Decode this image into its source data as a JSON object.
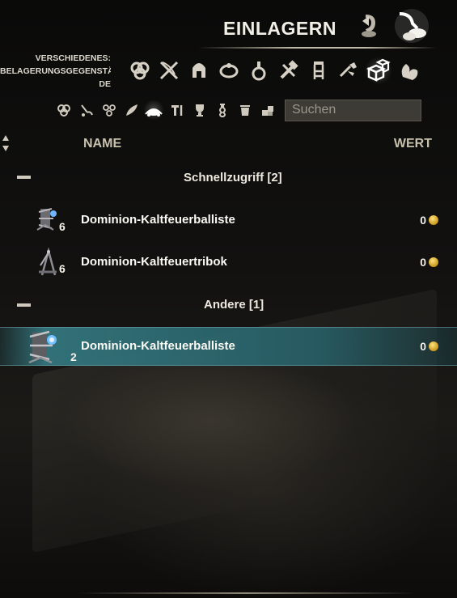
{
  "header": {
    "title": "EINLAGERN",
    "modes": [
      {
        "name": "withdraw-icon",
        "selected": false
      },
      {
        "name": "deposit-icon",
        "selected": true
      }
    ]
  },
  "category": {
    "label_line1": "VERSCHIEDENES:",
    "label_line2": "BELAGERUNGSGEGENSTÄN",
    "label_line3": "DE",
    "icons": [
      "all-icon",
      "weapons-icon",
      "armor-icon",
      "jewelry-icon",
      "consumables-icon",
      "crafting-icon",
      "furnishing-icon",
      "misc-icon",
      "siege-items-icon",
      "companion-icon"
    ],
    "selected_index": 8
  },
  "subfilters": {
    "icons": [
      "all-sub-icon",
      "tools-icon",
      "rings-icon",
      "horn-icon",
      "siege-sub-icon",
      "repair-icon",
      "trophy-icon",
      "potion-icon",
      "trash-icon",
      "boxes-icon"
    ],
    "selected_index": 4
  },
  "search": {
    "placeholder": "Suchen",
    "value": ""
  },
  "columns": {
    "name": "NAME",
    "value": "WERT"
  },
  "groups": [
    {
      "label": "Schnellzugriff [2]",
      "items": [
        {
          "name": "Dominion-Kaltfeuerballiste",
          "count": "6",
          "value": "0",
          "icon": "ballista-icon"
        },
        {
          "name": "Dominion-Kaltfeuertribok",
          "count": "6",
          "value": "0",
          "icon": "trebuchet-icon"
        }
      ]
    },
    {
      "label": "Andere [1]",
      "items": [
        {
          "name": "Dominion-Kaltfeuerballiste",
          "count": "2",
          "value": "0",
          "icon": "ballista-icon",
          "selected": true
        }
      ]
    }
  ],
  "colors": {
    "selected_row": "#347680",
    "accent_gold": "#e0b33a",
    "header_text": "#c8c1ae"
  }
}
